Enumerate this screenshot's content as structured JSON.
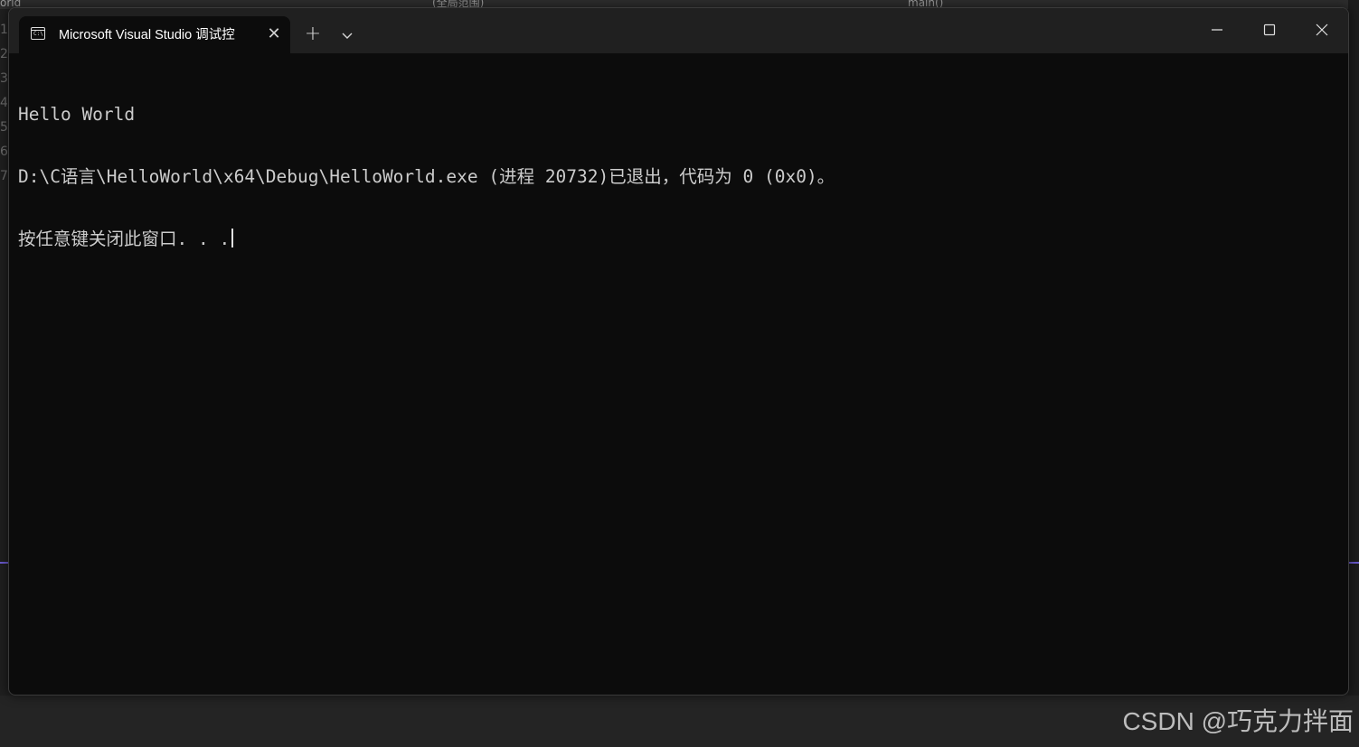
{
  "background_ide": {
    "top_left_text": "orld",
    "top_mid_text": "(全局范围)",
    "top_right_text": "main()",
    "gutter_numbers": [
      "1",
      "2",
      "3",
      "4",
      "5",
      "6",
      "7"
    ]
  },
  "window": {
    "tab": {
      "icon": "terminal-icon",
      "icon_glyph": "C:\\",
      "title": "Microsoft Visual Studio 调试控",
      "close_glyph": "✕"
    },
    "new_tab_glyph": "+",
    "dropdown_icon": "chevron-down-icon",
    "controls": {
      "minimize_icon": "minimize-icon",
      "maximize_icon": "maximize-icon",
      "close_icon": "close-icon"
    }
  },
  "console": {
    "lines": [
      "Hello World",
      "D:\\C语言\\HelloWorld\\x64\\Debug\\HelloWorld.exe (进程 20732)已退出，代码为 0 (0x0)。",
      "按任意键关闭此窗口. . ."
    ]
  },
  "watermark": "CSDN @巧克力拌面",
  "colors": {
    "console_bg": "#0c0c0c",
    "titlebar_bg": "#202020",
    "console_text": "#cccccc",
    "accent_purple": "#6a5acd"
  }
}
